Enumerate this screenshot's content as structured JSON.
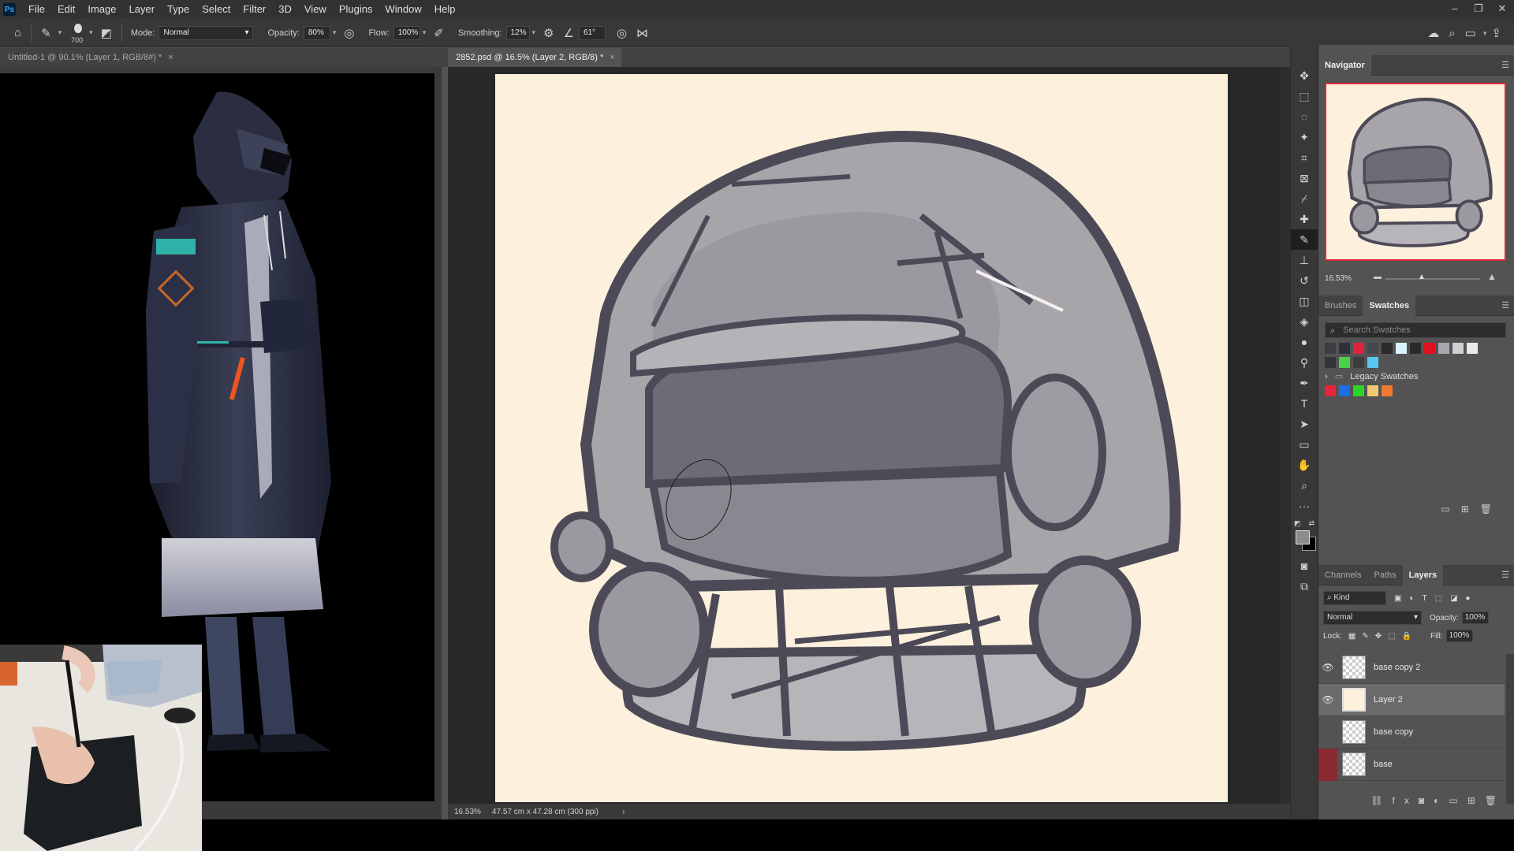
{
  "menu": {
    "logo": "Ps",
    "items": [
      "File",
      "Edit",
      "Image",
      "Layer",
      "Type",
      "Select",
      "Filter",
      "3D",
      "View",
      "Plugins",
      "Window",
      "Help"
    ]
  },
  "options": {
    "brush_size": "700",
    "mode_label": "Mode:",
    "mode_value": "Normal",
    "opacity_label": "Opacity:",
    "opacity_value": "80%",
    "flow_label": "Flow:",
    "flow_value": "100%",
    "smoothing_label": "Smoothing:",
    "smoothing_value": "12%",
    "angle_value": "61°"
  },
  "tabs": {
    "doc1": "Untitled-1 @ 90.1% (Layer 1, RGB/8#) *",
    "doc2": "2852.psd @ 16.5% (Layer 2, RGB/8) *"
  },
  "status": {
    "zoom": "16.53%",
    "size": "47.57 cm x 47.28 cm (300 ppi)"
  },
  "navigator": {
    "title": "Navigator",
    "zoom": "16.53%"
  },
  "swatches": {
    "tabs": [
      "Brushes",
      "Swatches"
    ],
    "search_placeholder": "Search Swatches",
    "legacy_label": "Legacy Swatches",
    "row1": [
      "#3c3c46",
      "#2f3039",
      "#e0243b",
      "#46464e",
      "#2a2a2a",
      "#d8f4ff",
      "#2a2a2a",
      "#e0101e",
      "#a8a8b0",
      "#d0d0d4",
      "#eaeaea"
    ],
    "row2": [
      "#33343c",
      "#4cd04c",
      "#3c3c3c",
      "#58c8f0"
    ],
    "legacy": [
      "#e8243c",
      "#1a6fe8",
      "#2ad62a",
      "#f0c870",
      "#f07830"
    ]
  },
  "layers": {
    "tabs": [
      "Channels",
      "Paths",
      "Layers"
    ],
    "kind_label": "Kind",
    "blend_mode": "Normal",
    "opacity_label": "Opacity:",
    "opacity_value": "100%",
    "lock_label": "Lock:",
    "fill_label": "Fill:",
    "fill_value": "100%",
    "items": [
      {
        "name": "base copy 2",
        "visible": true,
        "selected": false
      },
      {
        "name": "Layer 2",
        "visible": true,
        "selected": true
      },
      {
        "name": "base copy",
        "visible": false,
        "selected": false
      },
      {
        "name": "base",
        "visible": false,
        "selected": false
      }
    ]
  }
}
